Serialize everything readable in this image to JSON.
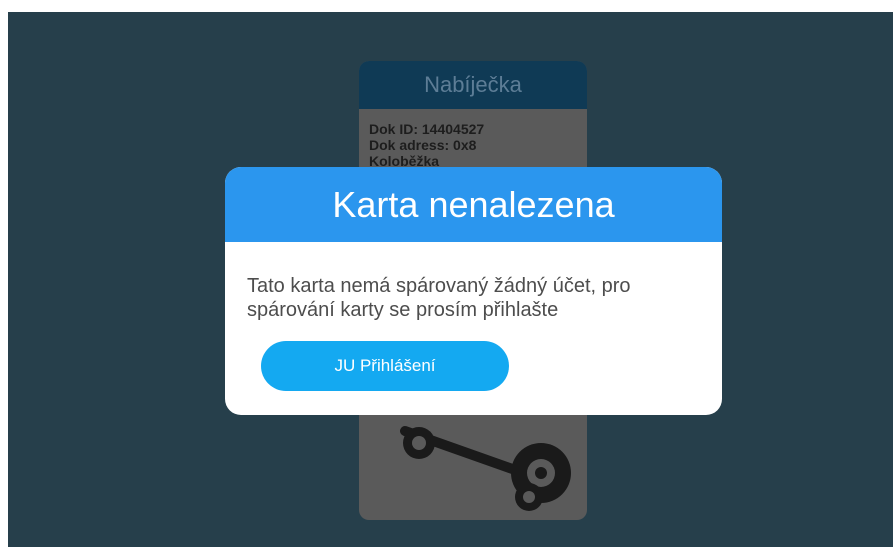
{
  "dock_card": {
    "title": "Nabíječka",
    "lines": [
      "Dok ID: 14404527",
      "Dok adress: 0x8",
      "Koloběžka"
    ]
  },
  "modal": {
    "title": "Karta nenalezena",
    "message_line1": "Tato karta nemá spárovaný žádný účet, pro",
    "message_line2": "spárování karty se prosím přihlašte",
    "login_button_label": "JU Přihlášení"
  },
  "colors": {
    "background": "#263f4b",
    "modal_header": "#2b96ee",
    "button": "#14a9f1"
  },
  "icons": {
    "scooter": "scooter-icon"
  }
}
